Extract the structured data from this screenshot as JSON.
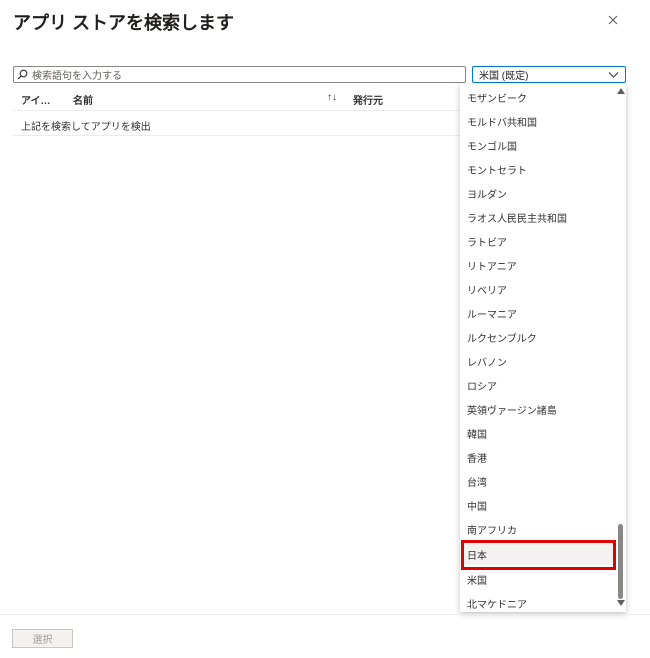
{
  "dialog": {
    "title": "アプリ ストアを検索します"
  },
  "search": {
    "placeholder": "検索語句を入力する"
  },
  "country_dropdown": {
    "selected": "米国 (既定)"
  },
  "table": {
    "columns": [
      "アイ…",
      "名前",
      "発行元"
    ],
    "sort_indicator": "↑↓",
    "empty_message": "上記を検索してアプリを検出"
  },
  "country_options": [
    "モザンビーク",
    "モルドバ共和国",
    "モンゴル国",
    "モントセラト",
    "ヨルダン",
    "ラオス人民民主共和国",
    "ラトビア",
    "リトアニア",
    "リベリア",
    "ルーマニア",
    "ルクセンブルク",
    "レバノン",
    "ロシア",
    "英領ヴァージン諸島",
    "韓国",
    "香港",
    "台湾",
    "中国",
    "南アフリカ",
    "日本",
    "米国",
    "北マケドニア"
  ],
  "highlighted_option": "日本",
  "footer": {
    "select_label": "選択"
  },
  "icons": {
    "close": "close-icon",
    "search": "search-icon",
    "chevron": "chevron-down-icon"
  },
  "colors": {
    "accent": "#0078d4",
    "highlight": "#e00000"
  }
}
